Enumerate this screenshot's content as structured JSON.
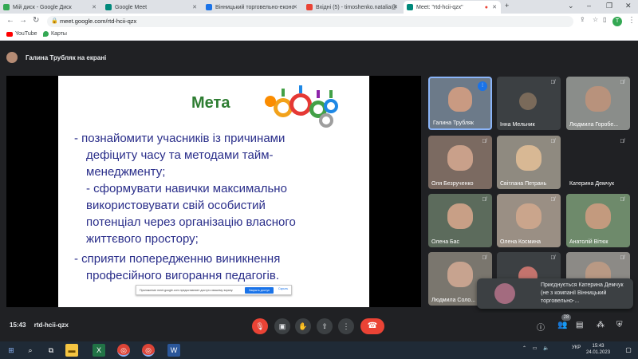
{
  "browser": {
    "tabs": [
      {
        "title": "Мій диск - Google Диск",
        "icon": "google-drive-icon",
        "color": "#34a853"
      },
      {
        "title": "Google Meet",
        "icon": "google-meet-icon",
        "color": "#00897b"
      },
      {
        "title": "Вінницький торговельно-еконо",
        "icon": "page-icon",
        "color": "#1a73e8"
      },
      {
        "title": "Вхідні (5) - timoshenko.natalia@",
        "icon": "gmail-icon",
        "color": "#ea4335"
      },
      {
        "title": "Meet: \"rtd-hcii-qzx\"",
        "icon": "google-meet-icon",
        "color": "#00897b"
      }
    ],
    "url": "meet.google.com/rtd-hcii-qzx",
    "bookmarks": [
      {
        "label": "YouTube",
        "icon": "youtube-icon"
      },
      {
        "label": "Карты",
        "icon": "maps-icon"
      }
    ],
    "profile_initial": "T"
  },
  "meet": {
    "presenting_banner": "Галина Трубляк на екрані",
    "slide": {
      "title": "Мета",
      "lines": [
        "- познайомити учасників із причинами",
        "дефіциту часу та методами тайм-",
        "менеджменту;",
        "- сформувати навички максимально",
        "використовувати свій особистий",
        "потенціал через організацію власного",
        "життєвого простору;",
        "- сприяти попередженню виникнення",
        "професійного вигорання педагогів."
      ]
    },
    "share_bar": {
      "text": "Приложение meet.google.com предоставляет доступ к вашему экрану.",
      "stop_label": "Закрыть доступ",
      "hide_label": "Скрыть"
    },
    "participants": [
      {
        "name": "Галина Трубляк",
        "speaking": true
      },
      {
        "name": "Інна Мельник",
        "speaking": false
      },
      {
        "name": "Людмила Горобе...",
        "speaking": false
      },
      {
        "name": "Оля Безрученко",
        "speaking": false
      },
      {
        "name": "Світлана Петрань",
        "speaking": false
      },
      {
        "name": "Катерина Демчук",
        "speaking": false
      },
      {
        "name": "Олена Бас",
        "speaking": false
      },
      {
        "name": "Олена Космина",
        "speaking": false
      },
      {
        "name": "Анатолій Вітюк",
        "speaking": false
      },
      {
        "name": "Людмила Соло...",
        "speaking": false
      },
      {
        "name": "",
        "speaking": false
      },
      {
        "name": "",
        "speaking": false
      }
    ],
    "notification": {
      "text": "Приєднується Катерина Демчук (не з компанії Вінницький торговельно-..."
    },
    "time": "15:43",
    "meeting_code": "rtd-hcii-qzx",
    "participant_count": "28"
  },
  "taskbar": {
    "tray_lang": "УКР",
    "tray_time": "15:43",
    "tray_date": "24.01.2023"
  },
  "colors": {
    "meet_bg": "#202124",
    "end_call": "#ea4335",
    "slide_title": "#2e7d32",
    "slide_text": "#2a2e8a",
    "accent": "#1a73e8"
  }
}
